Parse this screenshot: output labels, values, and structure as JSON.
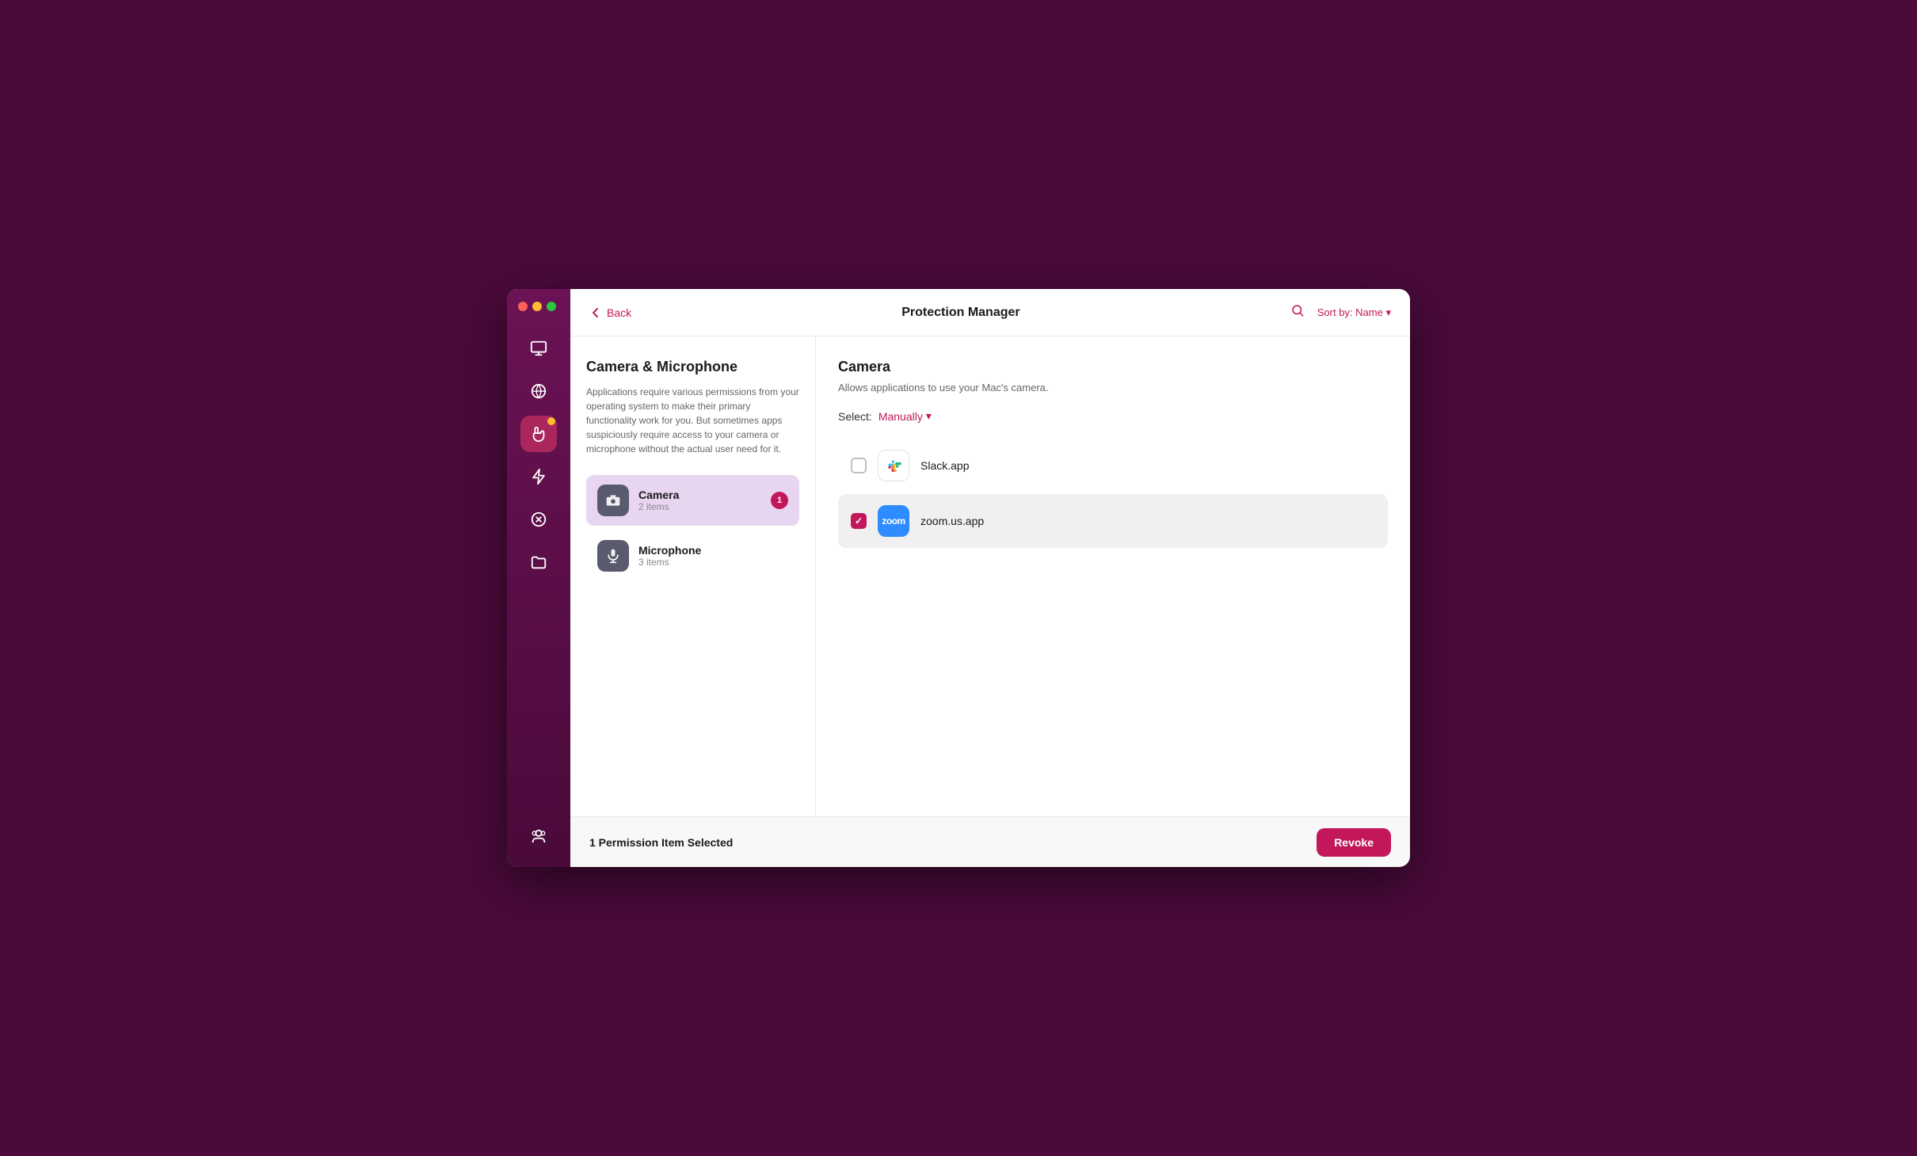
{
  "window": {
    "title": "Protection Manager"
  },
  "titlebar": {
    "back_label": "Back",
    "title": "Protection Manager",
    "sort_prefix": "Sort by:",
    "sort_value": "Name"
  },
  "left_panel": {
    "heading": "Camera & Microphone",
    "description": "Applications require various permissions from your operating system to make their primary functionality work for you. But sometimes apps suspiciously require access to your camera or microphone without the actual user need for it.",
    "categories": [
      {
        "name": "Camera",
        "count": "2 items",
        "badge": "1",
        "selected": true
      },
      {
        "name": "Microphone",
        "count": "3 items",
        "badge": "",
        "selected": false
      }
    ]
  },
  "right_panel": {
    "section_title": "Camera",
    "section_desc": "Allows applications to use your Mac's camera.",
    "select_label": "Select:",
    "select_value": "Manually",
    "apps": [
      {
        "name": "Slack.app",
        "checked": false,
        "highlighted": false
      },
      {
        "name": "zoom.us.app",
        "checked": true,
        "highlighted": true
      }
    ]
  },
  "footer": {
    "status": "1 Permission Item Selected",
    "revoke_label": "Revoke"
  },
  "sidebar": {
    "icons": [
      {
        "name": "display-icon",
        "symbol": "🖥",
        "active": false,
        "badge": false
      },
      {
        "name": "globe-icon",
        "symbol": "🌐",
        "active": false,
        "badge": false
      },
      {
        "name": "hand-icon",
        "symbol": "✋",
        "active": true,
        "badge": true
      },
      {
        "name": "bolt-icon",
        "symbol": "⚡",
        "active": false,
        "badge": false
      },
      {
        "name": "testflight-icon",
        "symbol": "⊗",
        "active": false,
        "badge": false
      },
      {
        "name": "folder-icon",
        "symbol": "📁",
        "active": false,
        "badge": false
      }
    ],
    "bottom_icon": {
      "name": "user-icon",
      "symbol": "👤"
    }
  }
}
